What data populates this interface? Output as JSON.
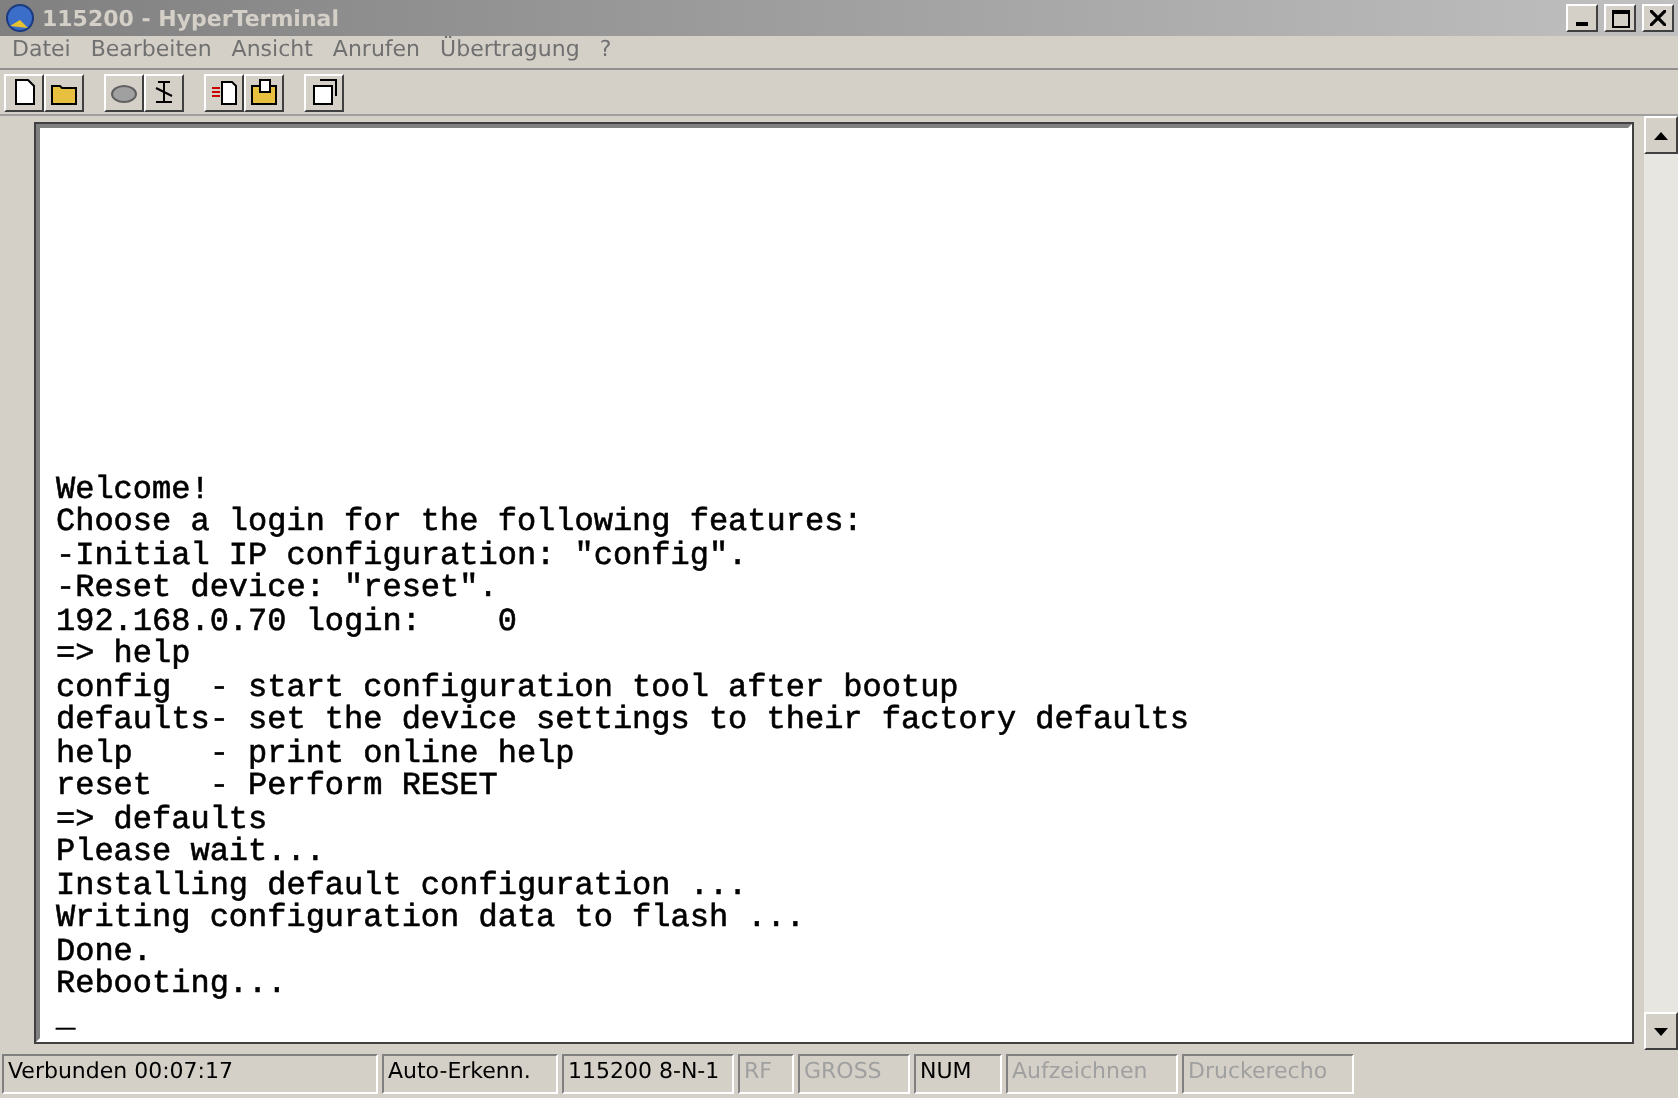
{
  "window": {
    "title": "115200 - HyperTerminal",
    "active": false
  },
  "menu": [
    "Datei",
    "Bearbeiten",
    "Ansicht",
    "Anrufen",
    "Übertragung",
    "?"
  ],
  "terminal": {
    "lines": [
      "Welcome!",
      "Choose a login for the following features:",
      "-Initial IP configuration: \"config\".",
      "-Reset device: \"reset\".",
      "192.168.0.70 login:    0",
      "=> help",
      "config  - start configuration tool after bootup",
      "defaults- set the device settings to their factory defaults",
      "help    - print online help",
      "reset   - Perform RESET",
      "=> defaults",
      "Please wait...",
      "Installing default configuration ...",
      "Writing configuration data to flash ...",
      "Done.",
      "Rebooting...",
      "_"
    ]
  },
  "status_bar": [
    {
      "text": "Verbunden 00:07:17",
      "disabled": false
    },
    {
      "text": "Auto-Erkenn.",
      "disabled": false
    },
    {
      "text": "115200 8-N-1",
      "disabled": false
    },
    {
      "text": "RF",
      "disabled": true
    },
    {
      "text": "GROSS",
      "disabled": true
    },
    {
      "text": "NUM",
      "disabled": false
    },
    {
      "text": "Aufzeichnen",
      "disabled": true
    },
    {
      "text": "Druckerecho",
      "disabled": true
    }
  ]
}
